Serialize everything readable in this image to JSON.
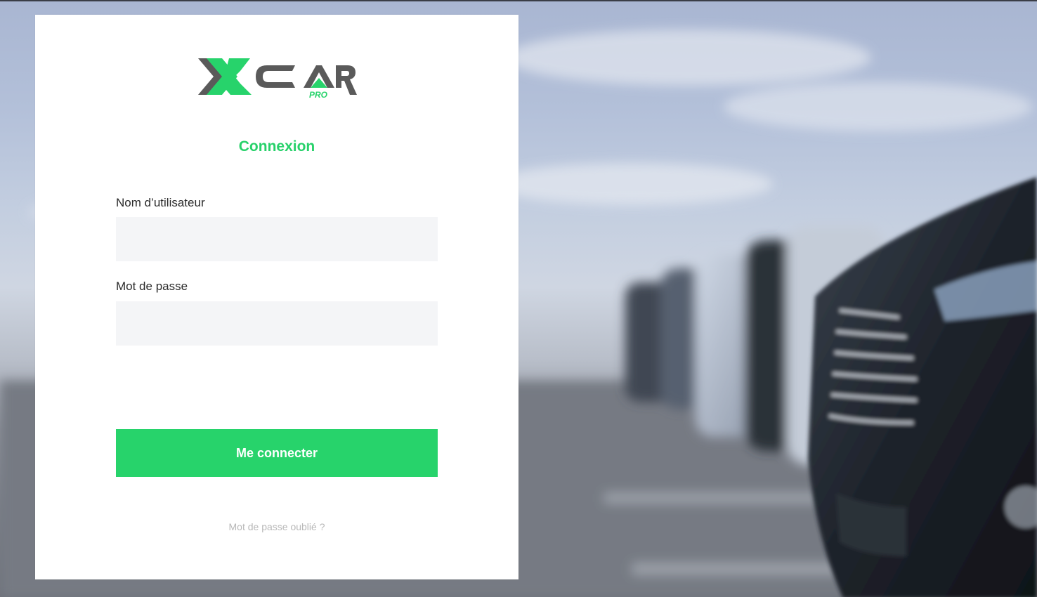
{
  "brand": {
    "logo_main": "XCAR",
    "logo_sub": "PRO",
    "accent_color": "#27d36b",
    "logo_gray": "#5a5a5a"
  },
  "login": {
    "title": "Connexion",
    "username_label": "Nom d’utilisateur",
    "username_value": "",
    "password_label": "Mot de passe",
    "password_value": "",
    "submit_label": "Me connecter",
    "forgot_label": "Mot de passe oublié ?"
  },
  "background": {
    "description_icon": "parked-cars-photo"
  }
}
